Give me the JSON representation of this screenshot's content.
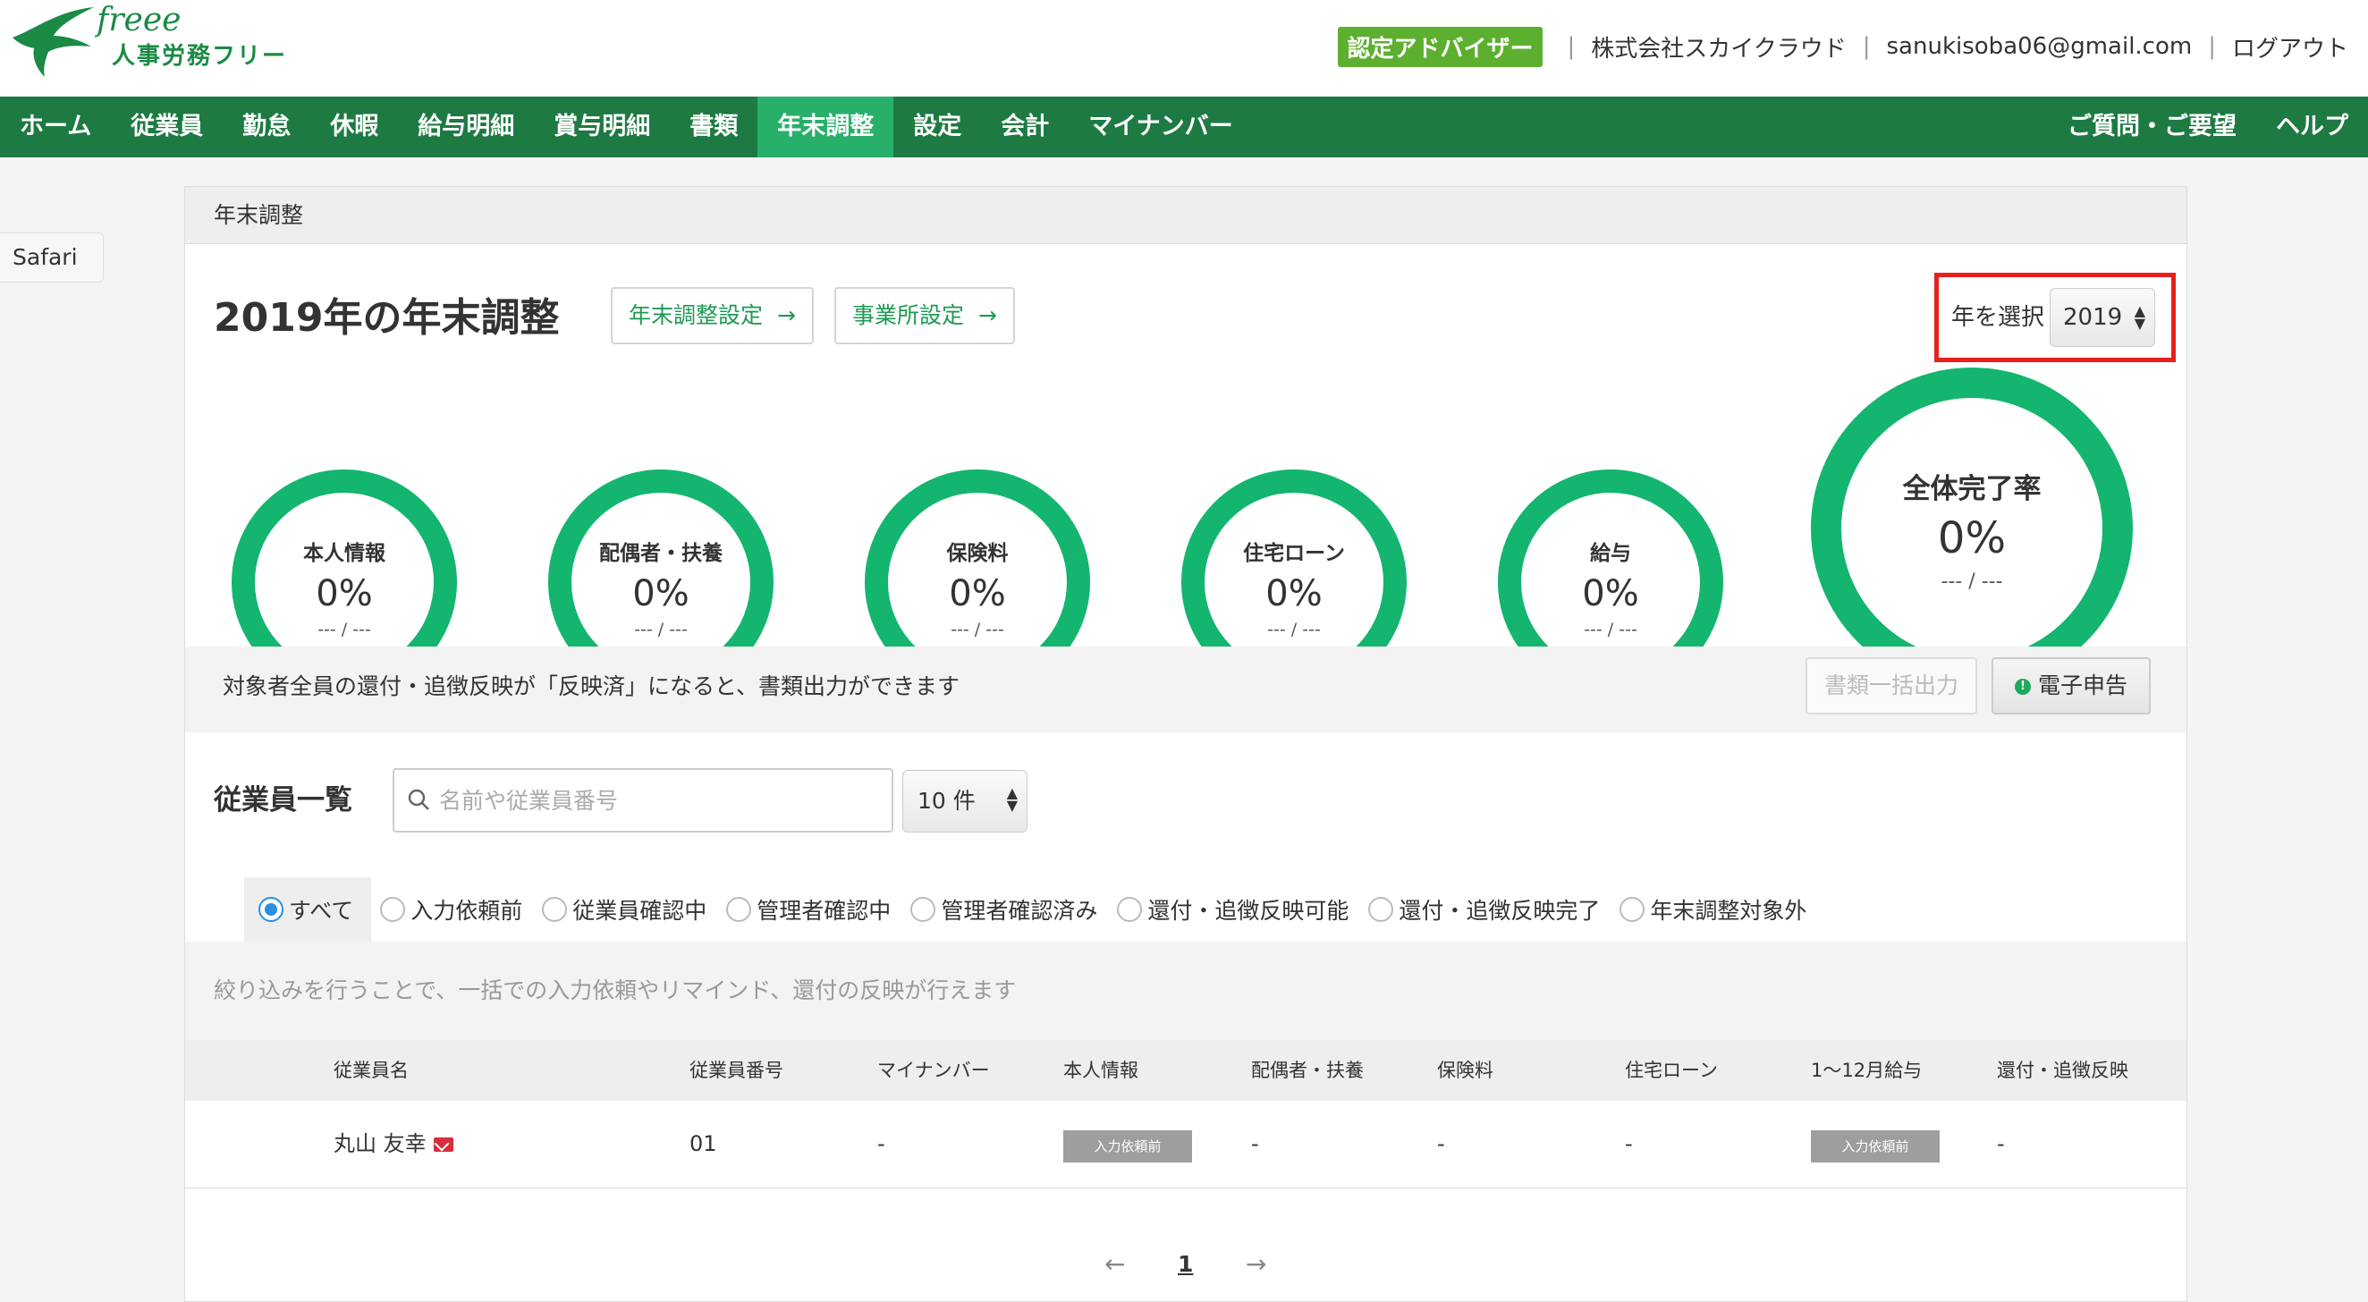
{
  "header": {
    "logo_script": "freee",
    "logo_text": "人事労務フリー",
    "advisor_badge": "認定アドバイザー",
    "company": "株式会社スカイクラウド",
    "email": "sanukisoba06@gmail.com",
    "logout": "ログアウト"
  },
  "nav": {
    "items": [
      "ホーム",
      "従業員",
      "勤怠",
      "休暇",
      "給与明細",
      "賞与明細",
      "書類",
      "年末調整",
      "設定",
      "会計",
      "マイナンバー"
    ],
    "active": "年末調整",
    "right": [
      "ご質問・ご要望",
      "ヘルプ"
    ]
  },
  "browser": {
    "safari_tab": "Safari"
  },
  "panel": {
    "breadcrumb": "年末調整",
    "title": "2019年の年末調整",
    "settings_button": "年末調整設定",
    "office_button": "事業所設定",
    "year_label": "年を選択",
    "year_value": "2019"
  },
  "progress": {
    "rings": [
      {
        "label": "本人情報",
        "percent": "0%",
        "count": "--- / ---"
      },
      {
        "label": "配偶者・扶養",
        "percent": "0%",
        "count": "--- / ---"
      },
      {
        "label": "保険料",
        "percent": "0%",
        "count": "--- / ---"
      },
      {
        "label": "住宅ローン",
        "percent": "0%",
        "count": "--- / ---"
      },
      {
        "label": "給与",
        "percent": "0%",
        "count": "--- / ---"
      }
    ],
    "overall": {
      "label": "全体完了率",
      "percent": "0%",
      "count": "--- / ---"
    }
  },
  "notice": {
    "text": "対象者全員の還付・追徴反映が「反映済」になると、書類出力ができます",
    "bulk_output": "書類一括出力",
    "efile": "電子申告"
  },
  "employees": {
    "title": "従業員一覧",
    "search_placeholder": "名前や従業員番号",
    "per_page": "10 件",
    "filters": [
      "すべて",
      "入力依頼前",
      "従業員確認中",
      "管理者確認中",
      "管理者確認済み",
      "還付・追徴反映可能",
      "還付・追徴反映完了",
      "年末調整対象外"
    ],
    "selected_filter": "すべて",
    "filter_hint": "絞り込みを行うことで、一括での入力依頼やリマインド、還付の反映が行えます",
    "columns": [
      "従業員名",
      "従業員番号",
      "マイナンバー",
      "本人情報",
      "配偶者・扶養",
      "保険料",
      "住宅ローン",
      "1〜12月給与",
      "還付・追徴反映"
    ],
    "rows": [
      {
        "name": "丸山 友幸",
        "number": "01",
        "my_number": "-",
        "personal": "入力依頼前",
        "spouse": "-",
        "insurance": "-",
        "housing": "-",
        "salary": "入力依頼前",
        "refund": "-"
      }
    ]
  },
  "pagination": {
    "prev": "←",
    "current": "1",
    "next": "→"
  },
  "colors": {
    "brand": "#1e7a43",
    "accent": "#28b06a",
    "ring": "#14b56f",
    "highlight": "#e8201a"
  }
}
